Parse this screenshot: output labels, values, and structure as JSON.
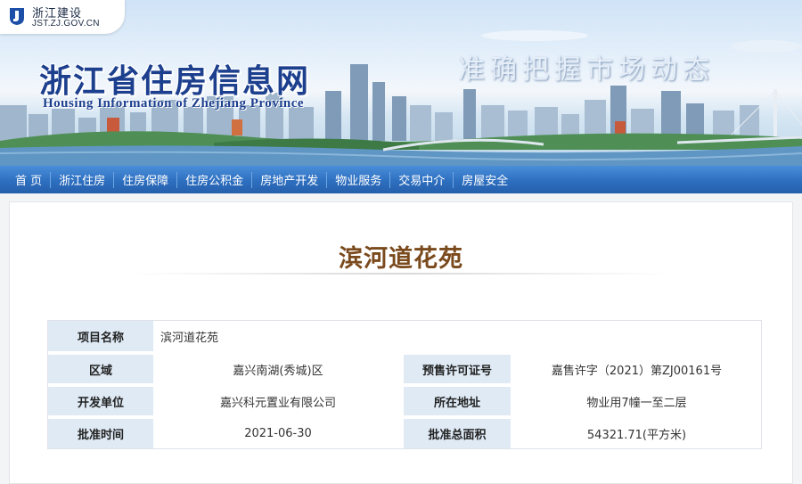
{
  "org_badge": {
    "name": "浙江建设",
    "domain": "JST.ZJ.GOV.CN"
  },
  "banner": {
    "title": "浙江省住房信息网",
    "subtitle": "Housing Information of Zhejiang Province",
    "slogan": "准确把握市场动态"
  },
  "nav": {
    "items": [
      {
        "label": "首 页"
      },
      {
        "label": "浙江住房"
      },
      {
        "label": "住房保障"
      },
      {
        "label": "住房公积金"
      },
      {
        "label": "房地产开发"
      },
      {
        "label": "物业服务"
      },
      {
        "label": "交易中介"
      },
      {
        "label": "房屋安全"
      }
    ]
  },
  "page": {
    "title": "滨河道花苑"
  },
  "project": {
    "name_label": "项目名称",
    "name_value": "滨河道花苑",
    "area_label": "区域",
    "area_value": "嘉兴南湖(秀城)区",
    "permit_label": "预售许可证号",
    "permit_value": "嘉售许字（2021）第ZJ00161号",
    "developer_label": "开发单位",
    "developer_value": "嘉兴科元置业有限公司",
    "location_label": "所在地址",
    "location_value": "物业用7幢一至二层",
    "approval_date_label": "批准时间",
    "approval_date_value": "2021-06-30",
    "total_area_label": "批准总面积",
    "total_area_value": "54321.71(平方米)"
  },
  "colors": {
    "nav_bg": "#2e6fc0",
    "title_brown": "#7a4a1d",
    "label_bg": "#dfeaf5",
    "site_title_blue": "#1c3f8e"
  }
}
